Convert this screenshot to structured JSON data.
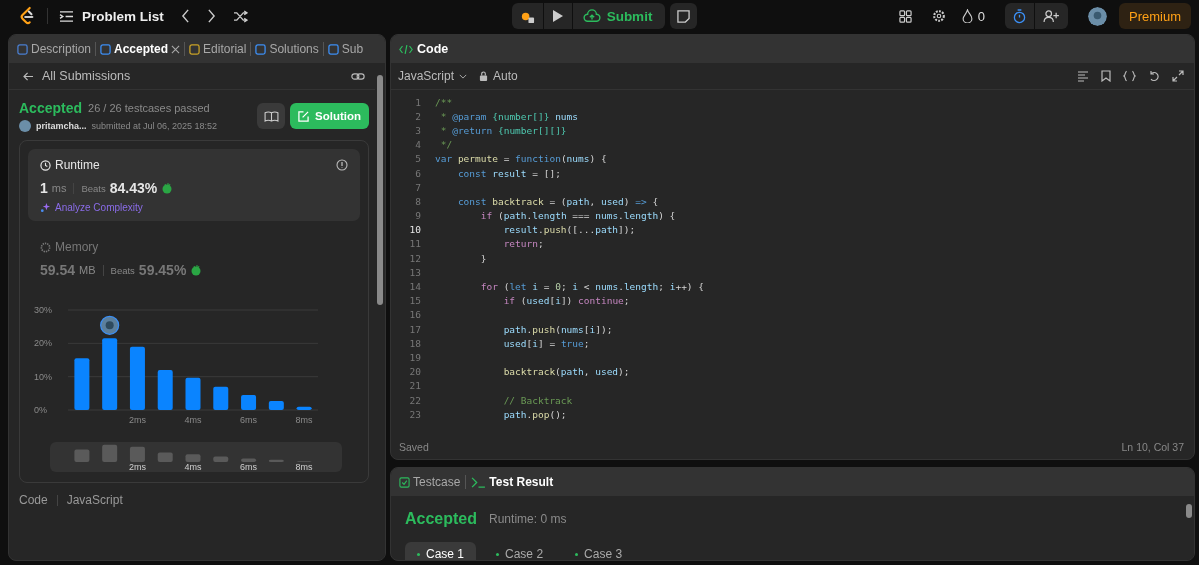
{
  "topbar": {
    "problem_list": "Problem List",
    "submit": "Submit",
    "streak": "0",
    "premium": "Premium",
    "timer_active": true
  },
  "left_tabs": [
    {
      "label": "Description",
      "selected": false,
      "kind": "description"
    },
    {
      "label": "Accepted",
      "selected": true,
      "kind": "accepted",
      "closable": true
    },
    {
      "label": "Editorial",
      "selected": false,
      "kind": "editorial"
    },
    {
      "label": "Solutions",
      "selected": false,
      "kind": "solutions"
    },
    {
      "label": "Sub",
      "selected": false,
      "kind": "submissions"
    }
  ],
  "back_link": "All Submissions",
  "submission": {
    "status": "Accepted",
    "passed": "26 / 26 testcases passed",
    "user": "pritamcha...",
    "submitted": "submitted at Jul 06, 2025 18:52",
    "solution_button": "Solution"
  },
  "metrics": [
    {
      "kind": "runtime",
      "title": "Runtime",
      "value": "1",
      "unit": "ms",
      "beats_label": "Beats",
      "beats": "84.43%",
      "selected": true,
      "action": "Analyze Complexity"
    },
    {
      "kind": "memory",
      "title": "Memory",
      "value": "59.54",
      "unit": "MB",
      "beats_label": "Beats",
      "beats": "59.45%",
      "selected": false
    }
  ],
  "chart_data": {
    "type": "bar",
    "x": [
      0,
      1,
      2,
      3,
      4,
      5,
      6,
      7,
      8
    ],
    "series": [
      {
        "color": "#0a84ff",
        "values": [
          15.5,
          21.5,
          19,
          12,
          9.7,
          7,
          4.5,
          2.7,
          1
        ]
      }
    ],
    "xlim": [
      -0.5,
      8.5
    ],
    "ylim": [
      0,
      30
    ],
    "yticks": [
      {
        "value": 0,
        "label": "0%"
      },
      {
        "value": 10,
        "label": "10%"
      },
      {
        "value": 20,
        "label": "20%"
      },
      {
        "value": 30,
        "label": "30%"
      }
    ],
    "xticks": [
      {
        "value": 2,
        "label": "2ms"
      },
      {
        "value": 4,
        "label": "4ms"
      },
      {
        "value": 6,
        "label": "6ms"
      },
      {
        "value": 8,
        "label": "8ms"
      }
    ]
  },
  "overview_labels": [
    "2ms",
    "4ms",
    "6ms",
    "8ms"
  ],
  "code_footer": {
    "label": "Code",
    "language": "JavaScript"
  },
  "editor": {
    "title": "Code",
    "language": "JavaScript",
    "mode": "Auto",
    "status": "Saved",
    "cursor": "Ln 10, Col 37",
    "lines": [
      {
        "no": "1",
        "active": false,
        "tokens": [
          {
            "text": "/**",
            "kind": "comment"
          }
        ]
      },
      {
        "no": "2",
        "active": false,
        "tokens": [
          {
            "text": " *",
            "kind": "comment"
          },
          {
            "text": " @param",
            "kind": "tag"
          },
          {
            "text": " {number[]}",
            "kind": "type"
          },
          {
            "text": " nums",
            "kind": "variable"
          }
        ]
      },
      {
        "no": "3",
        "active": false,
        "tokens": [
          {
            "text": " *",
            "kind": "comment"
          },
          {
            "text": " @return",
            "kind": "tag"
          },
          {
            "text": " {number[][]}",
            "kind": "type"
          }
        ]
      },
      {
        "no": "4",
        "active": false,
        "tokens": [
          {
            "text": " */",
            "kind": "comment"
          }
        ]
      },
      {
        "no": "5",
        "active": false,
        "tokens": [
          {
            "text": "var",
            "kind": "keyword"
          },
          {
            "text": " permute",
            "kind": "function"
          },
          {
            "text": " = ",
            "kind": "plain"
          },
          {
            "text": "function",
            "kind": "keyword"
          },
          {
            "text": "(",
            "kind": "plain"
          },
          {
            "text": "nums",
            "kind": "variable"
          },
          {
            "text": ") {",
            "kind": "plain"
          }
        ]
      },
      {
        "no": "6",
        "active": false,
        "tokens": [
          {
            "text": "    const",
            "kind": "keyword"
          },
          {
            "text": " result",
            "kind": "variable"
          },
          {
            "text": " = [];",
            "kind": "plain"
          }
        ]
      },
      {
        "no": "7",
        "active": false
      },
      {
        "no": "8",
        "active": false,
        "tokens": [
          {
            "text": "    const",
            "kind": "keyword"
          },
          {
            "text": " backtrack",
            "kind": "function"
          },
          {
            "text": " = (",
            "kind": "plain"
          },
          {
            "text": "path",
            "kind": "variable"
          },
          {
            "text": ", ",
            "kind": "plain"
          },
          {
            "text": "used",
            "kind": "variable"
          },
          {
            "text": ") ",
            "kind": "plain"
          },
          {
            "text": "=>",
            "kind": "keyword"
          },
          {
            "text": " {",
            "kind": "plain"
          }
        ]
      },
      {
        "no": "9",
        "active": false,
        "tokens": [
          {
            "text": "        if",
            "kind": "control"
          },
          {
            "text": " (",
            "kind": "plain"
          },
          {
            "text": "path",
            "kind": "variable"
          },
          {
            "text": ".",
            "kind": "plain"
          },
          {
            "text": "length",
            "kind": "variable"
          },
          {
            "text": " === ",
            "kind": "plain"
          },
          {
            "text": "nums",
            "kind": "variable"
          },
          {
            "text": ".",
            "kind": "plain"
          },
          {
            "text": "length",
            "kind": "variable"
          },
          {
            "text": ") {",
            "kind": "plain"
          }
        ]
      },
      {
        "no": "10",
        "active": true,
        "tokens": [
          {
            "text": "            result",
            "kind": "variable"
          },
          {
            "text": ".",
            "kind": "plain"
          },
          {
            "text": "push",
            "kind": "function"
          },
          {
            "text": "([...",
            "kind": "plain"
          },
          {
            "text": "path",
            "kind": "variable"
          },
          {
            "text": "]);",
            "kind": "plain"
          }
        ]
      },
      {
        "no": "11",
        "active": false,
        "tokens": [
          {
            "text": "            return",
            "kind": "control"
          },
          {
            "text": ";",
            "kind": "plain"
          }
        ]
      },
      {
        "no": "12",
        "active": false,
        "tokens": [
          {
            "text": "        }",
            "kind": "plain"
          }
        ]
      },
      {
        "no": "13",
        "active": false
      },
      {
        "no": "14",
        "active": false,
        "tokens": [
          {
            "text": "        for",
            "kind": "control"
          },
          {
            "text": " (",
            "kind": "plain"
          },
          {
            "text": "let",
            "kind": "keyword"
          },
          {
            "text": " i",
            "kind": "variable"
          },
          {
            "text": " = ",
            "kind": "plain"
          },
          {
            "text": "0",
            "kind": "number"
          },
          {
            "text": "; ",
            "kind": "plain"
          },
          {
            "text": "i",
            "kind": "variable"
          },
          {
            "text": " < ",
            "kind": "plain"
          },
          {
            "text": "nums",
            "kind": "variable"
          },
          {
            "text": ".",
            "kind": "plain"
          },
          {
            "text": "length",
            "kind": "variable"
          },
          {
            "text": "; ",
            "kind": "plain"
          },
          {
            "text": "i",
            "kind": "variable"
          },
          {
            "text": "++) {",
            "kind": "plain"
          }
        ]
      },
      {
        "no": "15",
        "active": false,
        "tokens": [
          {
            "text": "            if",
            "kind": "control"
          },
          {
            "text": " (",
            "kind": "plain"
          },
          {
            "text": "used",
            "kind": "variable"
          },
          {
            "text": "[",
            "kind": "plain"
          },
          {
            "text": "i",
            "kind": "variable"
          },
          {
            "text": "]) ",
            "kind": "plain"
          },
          {
            "text": "continue",
            "kind": "control"
          },
          {
            "text": ";",
            "kind": "plain"
          }
        ]
      },
      {
        "no": "16",
        "active": false
      },
      {
        "no": "17",
        "active": false,
        "tokens": [
          {
            "text": "            path",
            "kind": "variable"
          },
          {
            "text": ".",
            "kind": "plain"
          },
          {
            "text": "push",
            "kind": "function"
          },
          {
            "text": "(",
            "kind": "plain"
          },
          {
            "text": "nums",
            "kind": "variable"
          },
          {
            "text": "[",
            "kind": "plain"
          },
          {
            "text": "i",
            "kind": "variable"
          },
          {
            "text": "]);",
            "kind": "plain"
          }
        ]
      },
      {
        "no": "18",
        "active": false,
        "tokens": [
          {
            "text": "            used",
            "kind": "variable"
          },
          {
            "text": "[",
            "kind": "plain"
          },
          {
            "text": "i",
            "kind": "variable"
          },
          {
            "text": "] = ",
            "kind": "plain"
          },
          {
            "text": "true",
            "kind": "keyword"
          },
          {
            "text": ";",
            "kind": "plain"
          }
        ]
      },
      {
        "no": "19",
        "active": false
      },
      {
        "no": "20",
        "active": false,
        "tokens": [
          {
            "text": "            backtrack",
            "kind": "function"
          },
          {
            "text": "(",
            "kind": "plain"
          },
          {
            "text": "path",
            "kind": "variable"
          },
          {
            "text": ", ",
            "kind": "plain"
          },
          {
            "text": "used",
            "kind": "variable"
          },
          {
            "text": ");",
            "kind": "plain"
          }
        ]
      },
      {
        "no": "21",
        "active": false
      },
      {
        "no": "22",
        "active": false,
        "tokens": [
          {
            "text": "            // Backtrack",
            "kind": "comment"
          }
        ]
      },
      {
        "no": "23",
        "active": false,
        "tokens": [
          {
            "text": "            path",
            "kind": "variable"
          },
          {
            "text": ".",
            "kind": "plain"
          },
          {
            "text": "pop",
            "kind": "function"
          },
          {
            "text": "();",
            "kind": "plain"
          }
        ]
      }
    ]
  },
  "bottom_tabs": [
    {
      "label": "Testcase",
      "selected": false,
      "kind": "testcase"
    },
    {
      "label": "Test Result",
      "selected": true,
      "kind": "result"
    }
  ],
  "result": {
    "status": "Accepted",
    "runtime": "Runtime: 0 ms"
  },
  "cases": [
    {
      "label": "Case 1",
      "selected": true
    },
    {
      "label": "Case 2",
      "selected": false
    },
    {
      "label": "Case 3",
      "selected": false
    }
  ]
}
